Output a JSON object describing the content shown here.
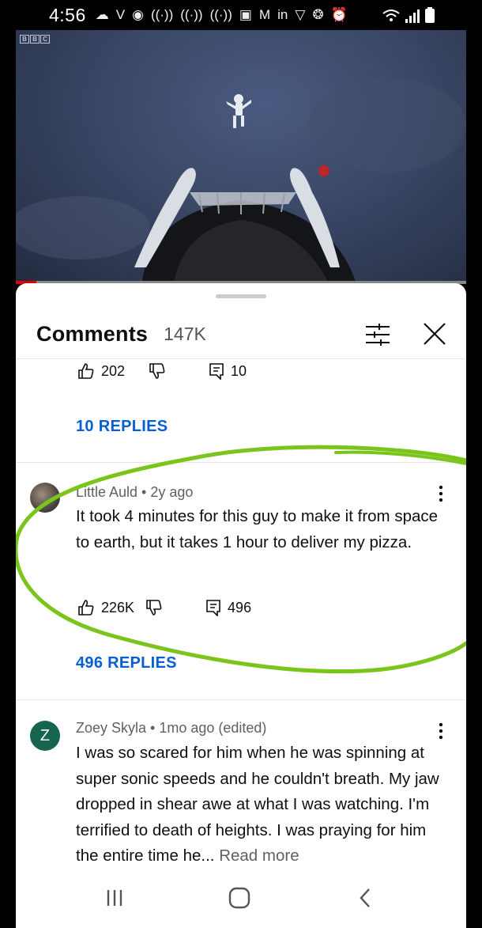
{
  "status_bar": {
    "time": "4:56",
    "icons": [
      "snapchat-icon",
      "v-icon",
      "cast-icon",
      "signal-broadcast-icon",
      "signal-broadcast-icon",
      "signal-broadcast-icon",
      "twitch-icon",
      "gmail-icon",
      "linkedin-icon",
      "vpn-icon",
      "basketball-icon",
      "alarm-icon",
      "wifi-icon",
      "cellular-icon",
      "battery-icon"
    ]
  },
  "video": {
    "channel_logo": [
      "B",
      "B",
      "C"
    ],
    "progress_percent": 4.5,
    "progress_color": "#e00000"
  },
  "comments_panel": {
    "title": "Comments",
    "count": "147K"
  },
  "prev_comment": {
    "likes": "202",
    "reply_count": "10",
    "replies_link": "10 REPLIES"
  },
  "comments": [
    {
      "author": "Little Auld",
      "age": "2y ago",
      "meta": "Little Auld • 2y ago",
      "text": "It took 4 minutes for this guy to make it from space to earth, but it takes 1 hour to deliver my pizza.",
      "likes": "226K",
      "reply_count": "496",
      "replies_link": "496 REPLIES"
    },
    {
      "author": "Zoey Skyla",
      "avatar_letter": "Z",
      "meta": "Zoey Skyla • 1mo ago (edited)",
      "text": "I was so scared for him when he was spinning at super sonic speeds and he couldn't breath. My jaw dropped in shear awe at what I was watching. I'm terrified to death of heights. I was praying for him the entire time he...",
      "read_more": "Read more"
    }
  ],
  "colors": {
    "link_blue": "#065fd4",
    "annotation_green": "#7ac51b",
    "avatar_green": "#17654f"
  }
}
